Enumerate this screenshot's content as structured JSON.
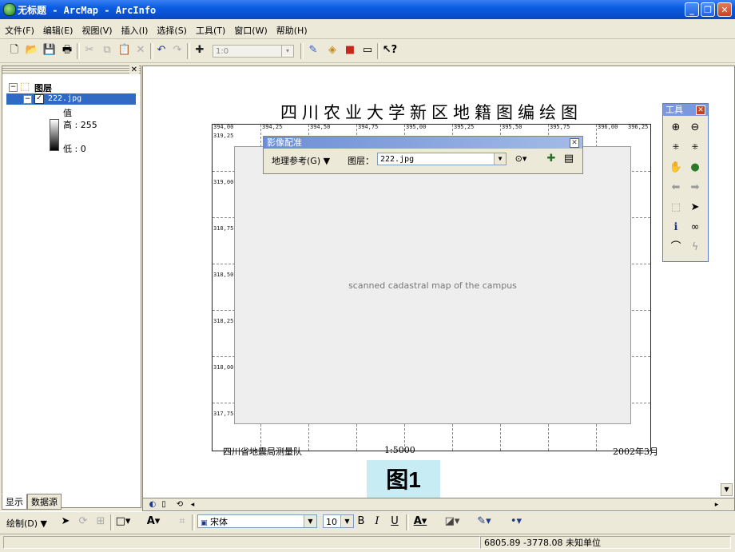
{
  "window": {
    "title": "无标题 - ArcMap - ArcInfo",
    "min": "_",
    "max": "❐",
    "close": "✕"
  },
  "menu": [
    "文件(F)",
    "编辑(E)",
    "视图(V)",
    "插入(I)",
    "选择(S)",
    "工具(T)",
    "窗口(W)",
    "帮助(H)"
  ],
  "toolbar": {
    "scale_value": "1:0",
    "scale_dropdown": "▾"
  },
  "toc": {
    "root_label": "图层",
    "layer_name": "222.jpg",
    "value_label": "值",
    "high_label": "高 : 255",
    "low_label": "低 : 0",
    "tabs": [
      "显示",
      "数据源"
    ],
    "close": "✕"
  },
  "map": {
    "title": "四川农业大学新区地籍图编绘图",
    "x_ticks": [
      "394,00",
      "394,25",
      "394,50",
      "394,75",
      "395,00",
      "395,25",
      "395,50",
      "395,75",
      "396,00",
      "396,25"
    ],
    "y_ticks": [
      "319,25",
      "319,00",
      "318,75",
      "318,50",
      "318,25",
      "318,00",
      "317,75"
    ],
    "footer_left": "四川省地震局测量队",
    "footer_scale": "1:5000",
    "footer_date": "2002年3月",
    "art_alt": "scanned cadastral map of the campus"
  },
  "caption": "图1",
  "georef": {
    "title": "影像配准",
    "menu_label": "地理参考(G) ▼",
    "layer_label": "图层：",
    "layer_value": "222.jpg",
    "close": "✕"
  },
  "tools": {
    "title": "工具",
    "close": "✕"
  },
  "draw": {
    "menu_label": "绘制(D) ▼",
    "font_name": "宋体",
    "font_size": "10",
    "bold": "B",
    "italic": "I",
    "underline": "U"
  },
  "status": {
    "coords": "6805.89  -3778.08 未知单位"
  }
}
